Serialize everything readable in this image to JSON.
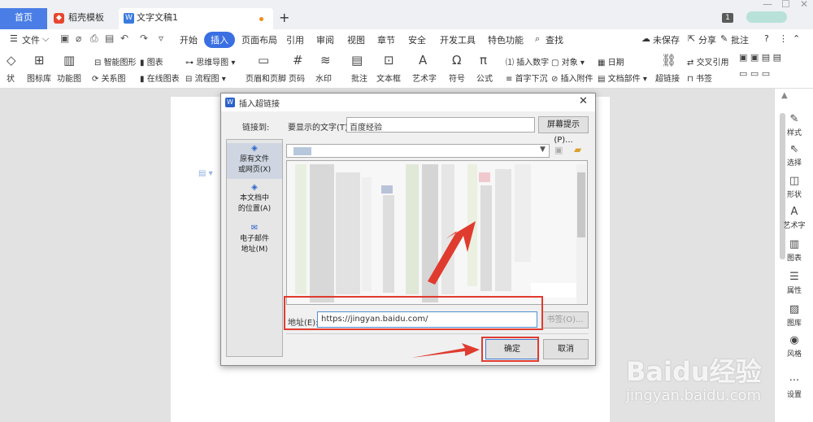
{
  "tabs": {
    "home": "首页",
    "templates": "稻壳模板",
    "templates_icon": "wps-icon",
    "document": "文字文稿1",
    "document_icon": "W",
    "add": "+"
  },
  "window": {
    "badge": "1"
  },
  "menu": {
    "file": "文件",
    "items": [
      "开始",
      "插入",
      "页面布局",
      "引用",
      "审阅",
      "视图",
      "章节",
      "安全",
      "开发工具",
      "特色功能"
    ],
    "search": "查找",
    "unsaved": "未保存",
    "share": "分享",
    "comment": "批注"
  },
  "ribbon": {
    "row1": [
      "智能图形",
      "图表",
      "思维导图",
      "插入数字",
      "对象",
      "日期",
      "交叉引用"
    ],
    "row2": [
      "状",
      "图标库",
      "功能图",
      "关系图",
      "在线图表",
      "流程图",
      "页眉和页脚",
      "页码",
      "水印",
      "批注",
      "文本框",
      "艺术字",
      "符号",
      "公式",
      "首字下沉",
      "插入附件",
      "文档部件",
      "超链接",
      "书签"
    ]
  },
  "sidebar": {
    "items": [
      "样式",
      "选择",
      "形状",
      "艺术字",
      "图表",
      "属性",
      "图库",
      "风格",
      "设置"
    ]
  },
  "dialog": {
    "title": "插入超链接",
    "title_icon": "W",
    "link_to_label": "链接到:",
    "display_text_label": "要显示的文字(T):",
    "display_text_value": "百度经验",
    "screen_tip_button": "屏幕提示(P)...",
    "link_targets": [
      {
        "line1": "原有文件",
        "line2": "或网页(X)"
      },
      {
        "line1": "本文档中",
        "line2": "的位置(A)"
      },
      {
        "line1": "电子邮件",
        "line2": "地址(M)"
      }
    ],
    "address_label": "地址(E):",
    "address_value": "https://jingyan.baidu.com/",
    "bookmark_button": "书签(O)...",
    "ok_button": "确定",
    "cancel_button": "取消"
  },
  "watermark": {
    "brand": "Baidu经验",
    "url": "jingyan.baidu.com"
  },
  "colors": {
    "accent": "#3a6fe2",
    "annotation": "#e03b2f"
  }
}
